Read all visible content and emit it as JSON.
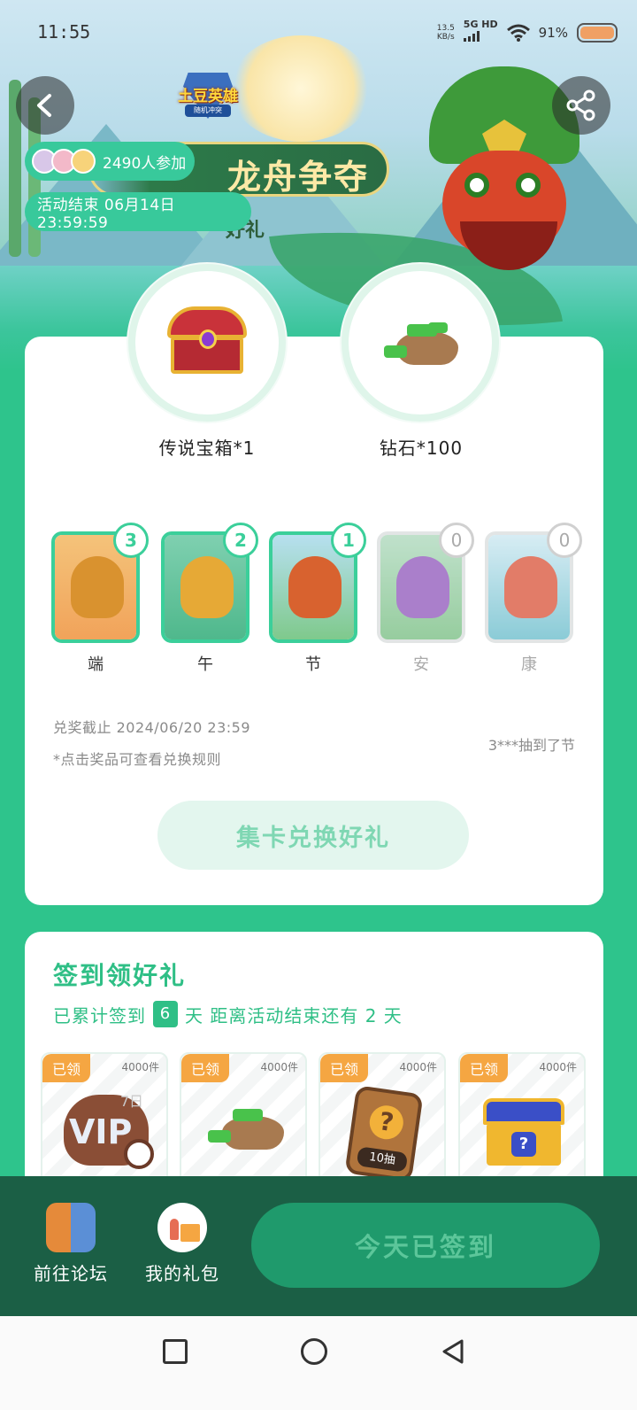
{
  "status": {
    "time": "11:55",
    "net_speed_value": "13.5",
    "net_speed_unit": "KB/s",
    "network": "5G HD",
    "battery": "91%"
  },
  "header": {
    "logo_text": "土豆英雄",
    "logo_sub": "随机冲突",
    "title": "龙舟争夺",
    "subtitle": "好礼",
    "participants": "2490人参加",
    "end_time": "活动结束 06月14日 23:59:59"
  },
  "prizes": [
    {
      "label": "传说宝箱*1",
      "icon": "treasure-chest-icon"
    },
    {
      "label": "钻石*100",
      "icon": "diamond-bag-icon"
    }
  ],
  "collect_cards": [
    {
      "name": "端",
      "count": "3",
      "collected": true
    },
    {
      "name": "午",
      "count": "2",
      "collected": true
    },
    {
      "name": "节",
      "count": "1",
      "collected": true
    },
    {
      "name": "安",
      "count": "0",
      "collected": false
    },
    {
      "name": "康",
      "count": "0",
      "collected": false
    }
  ],
  "exchange": {
    "deadline": "兑奖截止 2024/06/20 23:59",
    "hint": "*点击奖品可查看兑换规则",
    "ticker": "3***抽到了节",
    "button": "集卡兑换好礼"
  },
  "signin": {
    "title": "签到领好礼",
    "prefix": "已累计签到",
    "days": "6",
    "suffix": "天  距离活动结束还有 2 天",
    "rewards": [
      {
        "tag": "已领",
        "qty": "4000件",
        "badge": "7日"
      },
      {
        "tag": "已领",
        "qty": "4000件"
      },
      {
        "tag": "已领",
        "qty": "4000件",
        "badge": "10抽"
      },
      {
        "tag": "已领",
        "qty": "4000件"
      }
    ]
  },
  "bottom": {
    "forum_label": "前往论坛",
    "gift_label": "我的礼包",
    "sign_button": "今天已签到"
  },
  "colors": {
    "primary_green": "#2ec48c",
    "dark_green": "#1b5f45",
    "tag_orange": "#f5a642"
  }
}
